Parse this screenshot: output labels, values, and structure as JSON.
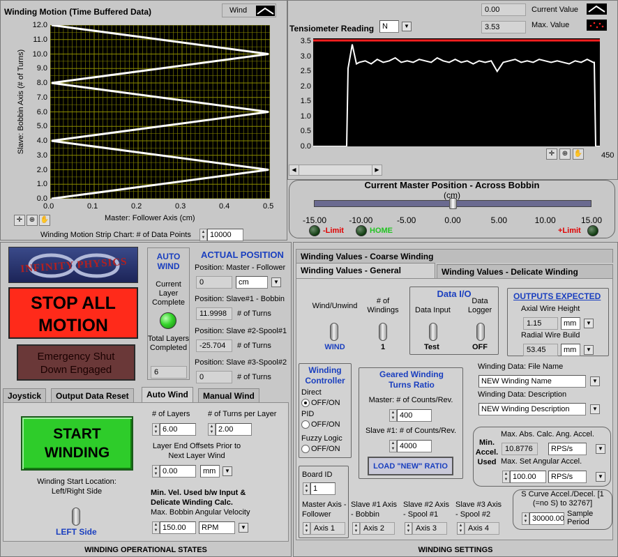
{
  "motion_chart": {
    "title": "Winding Motion (Time Buffered Data)",
    "legend": "Wind",
    "ylabel": "Slave: Bobbin Axis (# of Turns)",
    "xlabel": "Master: Follower Axis (cm)",
    "yticks": [
      "12.0",
      "11.0",
      "10.0",
      "9.0",
      "8.0",
      "7.0",
      "6.0",
      "5.0",
      "4.0",
      "3.0",
      "2.0",
      "1.0",
      "0.0"
    ],
    "xticks": [
      "0.0",
      "0.1",
      "0.2",
      "0.3",
      "0.4",
      "0.5"
    ],
    "points_label": "Winding Motion Strip Chart: # of Data Points",
    "points_value": "10000"
  },
  "tension": {
    "title": "Tensiometer Reading",
    "unit": "N",
    "current_value": "0.00",
    "current_label": "Current Value",
    "max_value": "3.53",
    "max_label": "Max. Value",
    "yticks": [
      "3.5",
      "3.0",
      "2.5",
      "2.0",
      "1.5",
      "1.0",
      "0.5",
      "0.0"
    ],
    "xmax_label": "450"
  },
  "position": {
    "title": "Current Master Position - Across Bobbin",
    "unit": "(cm)",
    "ticks": [
      "-15.00",
      "-10.00",
      "-5.00",
      "0.00",
      "5.00",
      "10.00",
      "15.00"
    ],
    "minus_limit": "-Limit",
    "home": "HOME",
    "plus_limit": "+Limit"
  },
  "left": {
    "logo": "INFINITY PHYSICS",
    "stop_all": "STOP ALL MOTION",
    "emergency": "Emergency Shut Down Engaged",
    "auto_wind": "AUTO WIND",
    "current_layer": "Current Layer Complete",
    "total_layers": "Total Layers Completed",
    "total_layers_value": "6",
    "actual_position": "ACTUAL POSITION",
    "pos_master_label": "Position: Master - Follower",
    "pos_master_value": "0",
    "pos_master_unit": "cm",
    "pos_slave1_label": "Position: Slave#1 - Bobbin",
    "pos_slave1_value": "11.9998",
    "pos_slave2_label": "Position: Slave #2-Spool#1",
    "pos_slave2_value": "-25.704",
    "pos_slave3_label": "Position: Slave #3-Spool#2",
    "pos_slave3_value": "0",
    "turns": "# of Turns",
    "tabs": [
      "Joystick",
      "Output Data Reset",
      "Auto Wind",
      "Manual Wind"
    ],
    "start_winding": "START WINDING",
    "start_location": "Winding Start Location: Left/Right Side",
    "left_side": "LEFT Side",
    "num_layers_label": "# of Layers",
    "num_layers_value": "6.00",
    "turns_per_layer_label": "# of Turns per Layer",
    "turns_per_layer_value": "2.00",
    "layer_end_label": "Layer End Offsets Prior to Next Layer Wind",
    "layer_end_value": "0.00",
    "layer_end_unit": "mm",
    "minvel_label": "Min. Vel. Used b/w Input & Delicate Winding Calc.",
    "max_bobbin_label": "Max. Bobbin Angular Velocity",
    "max_bobbin_value": "150.00",
    "max_bobbin_unit": "RPM",
    "footer": "WINDING OPERATIONAL STATES"
  },
  "right": {
    "tab_coarse": "Winding Values - Coarse Winding",
    "tab_general": "Winding Values - General",
    "tab_delicate": "Winding Values - Delicate Winding",
    "wind_unwind": "Wind/Unwind",
    "wind": "WIND",
    "num_windings": "# of Windings",
    "num_windings_value": "1",
    "data_io": "Data I/O",
    "data_input": "Data Input",
    "data_input_value": "Test",
    "data_logger": "Data Logger",
    "data_logger_value": "OFF",
    "outputs_expected": "OUTPUTS EXPECTED",
    "axial_label": "Axial Wire Height",
    "axial_value": "1.15",
    "axial_unit": "mm",
    "radial_label": "Radial Wire Build",
    "radial_value": "53.45",
    "radial_unit": "mm",
    "controller": "Winding Controller",
    "direct": "Direct",
    "offon": "OFF/ON",
    "pid": "PID",
    "fuzzy": "Fuzzy Logic",
    "geared": "Geared Winding Turns Ratio",
    "master_counts_label": "Master: # of Counts/Rev.",
    "master_counts_value": "400",
    "slave_counts_label": "Slave #1: # of Counts/Rev.",
    "slave_counts_value": "4000",
    "load_ratio": "LOAD \"NEW\" RATIO",
    "file_name_label": "Winding Data: File Name",
    "file_name_value": "NEW Winding Name",
    "description_label": "Winding Data: Description",
    "description_value": "NEW Winding Description",
    "min_accel": "Min. Accel. Used",
    "max_abs_label": "Max. Abs. Calc. Ang. Accel.",
    "max_abs_value": "10.8776",
    "max_abs_unit": "RPS/s",
    "max_set_label": "Max. Set Angular Accel.",
    "max_set_value": "100.00",
    "max_set_unit": "RPS/s",
    "board_id_label": "Board ID",
    "board_id_value": "1",
    "master_axis_label": "Master Axis - Follower",
    "master_axis_value": "Axis 1",
    "slave1_axis_label": "Slave #1 Axis - Bobbin",
    "slave1_axis_value": "Axis 2",
    "slave2_axis_label": "Slave #2 Axis - Spool #1",
    "slave2_axis_value": "Axis 3",
    "slave3_axis_label": "Slave #3 Axis - Spool #2",
    "slave3_axis_value": "Axis 4",
    "scurve_label": "S Curve Accel./Decel. [1 (=no S) to 32767]",
    "scurve_value": "30000.00",
    "sample_period": "Sample Period",
    "footer": "WINDING SETTINGS"
  },
  "colors": {
    "led_on": "#35d42a",
    "stop": "#ff2a1a",
    "start": "#2ecc2a",
    "max_line": "#ff2020",
    "grid": "#8c8c00"
  }
}
